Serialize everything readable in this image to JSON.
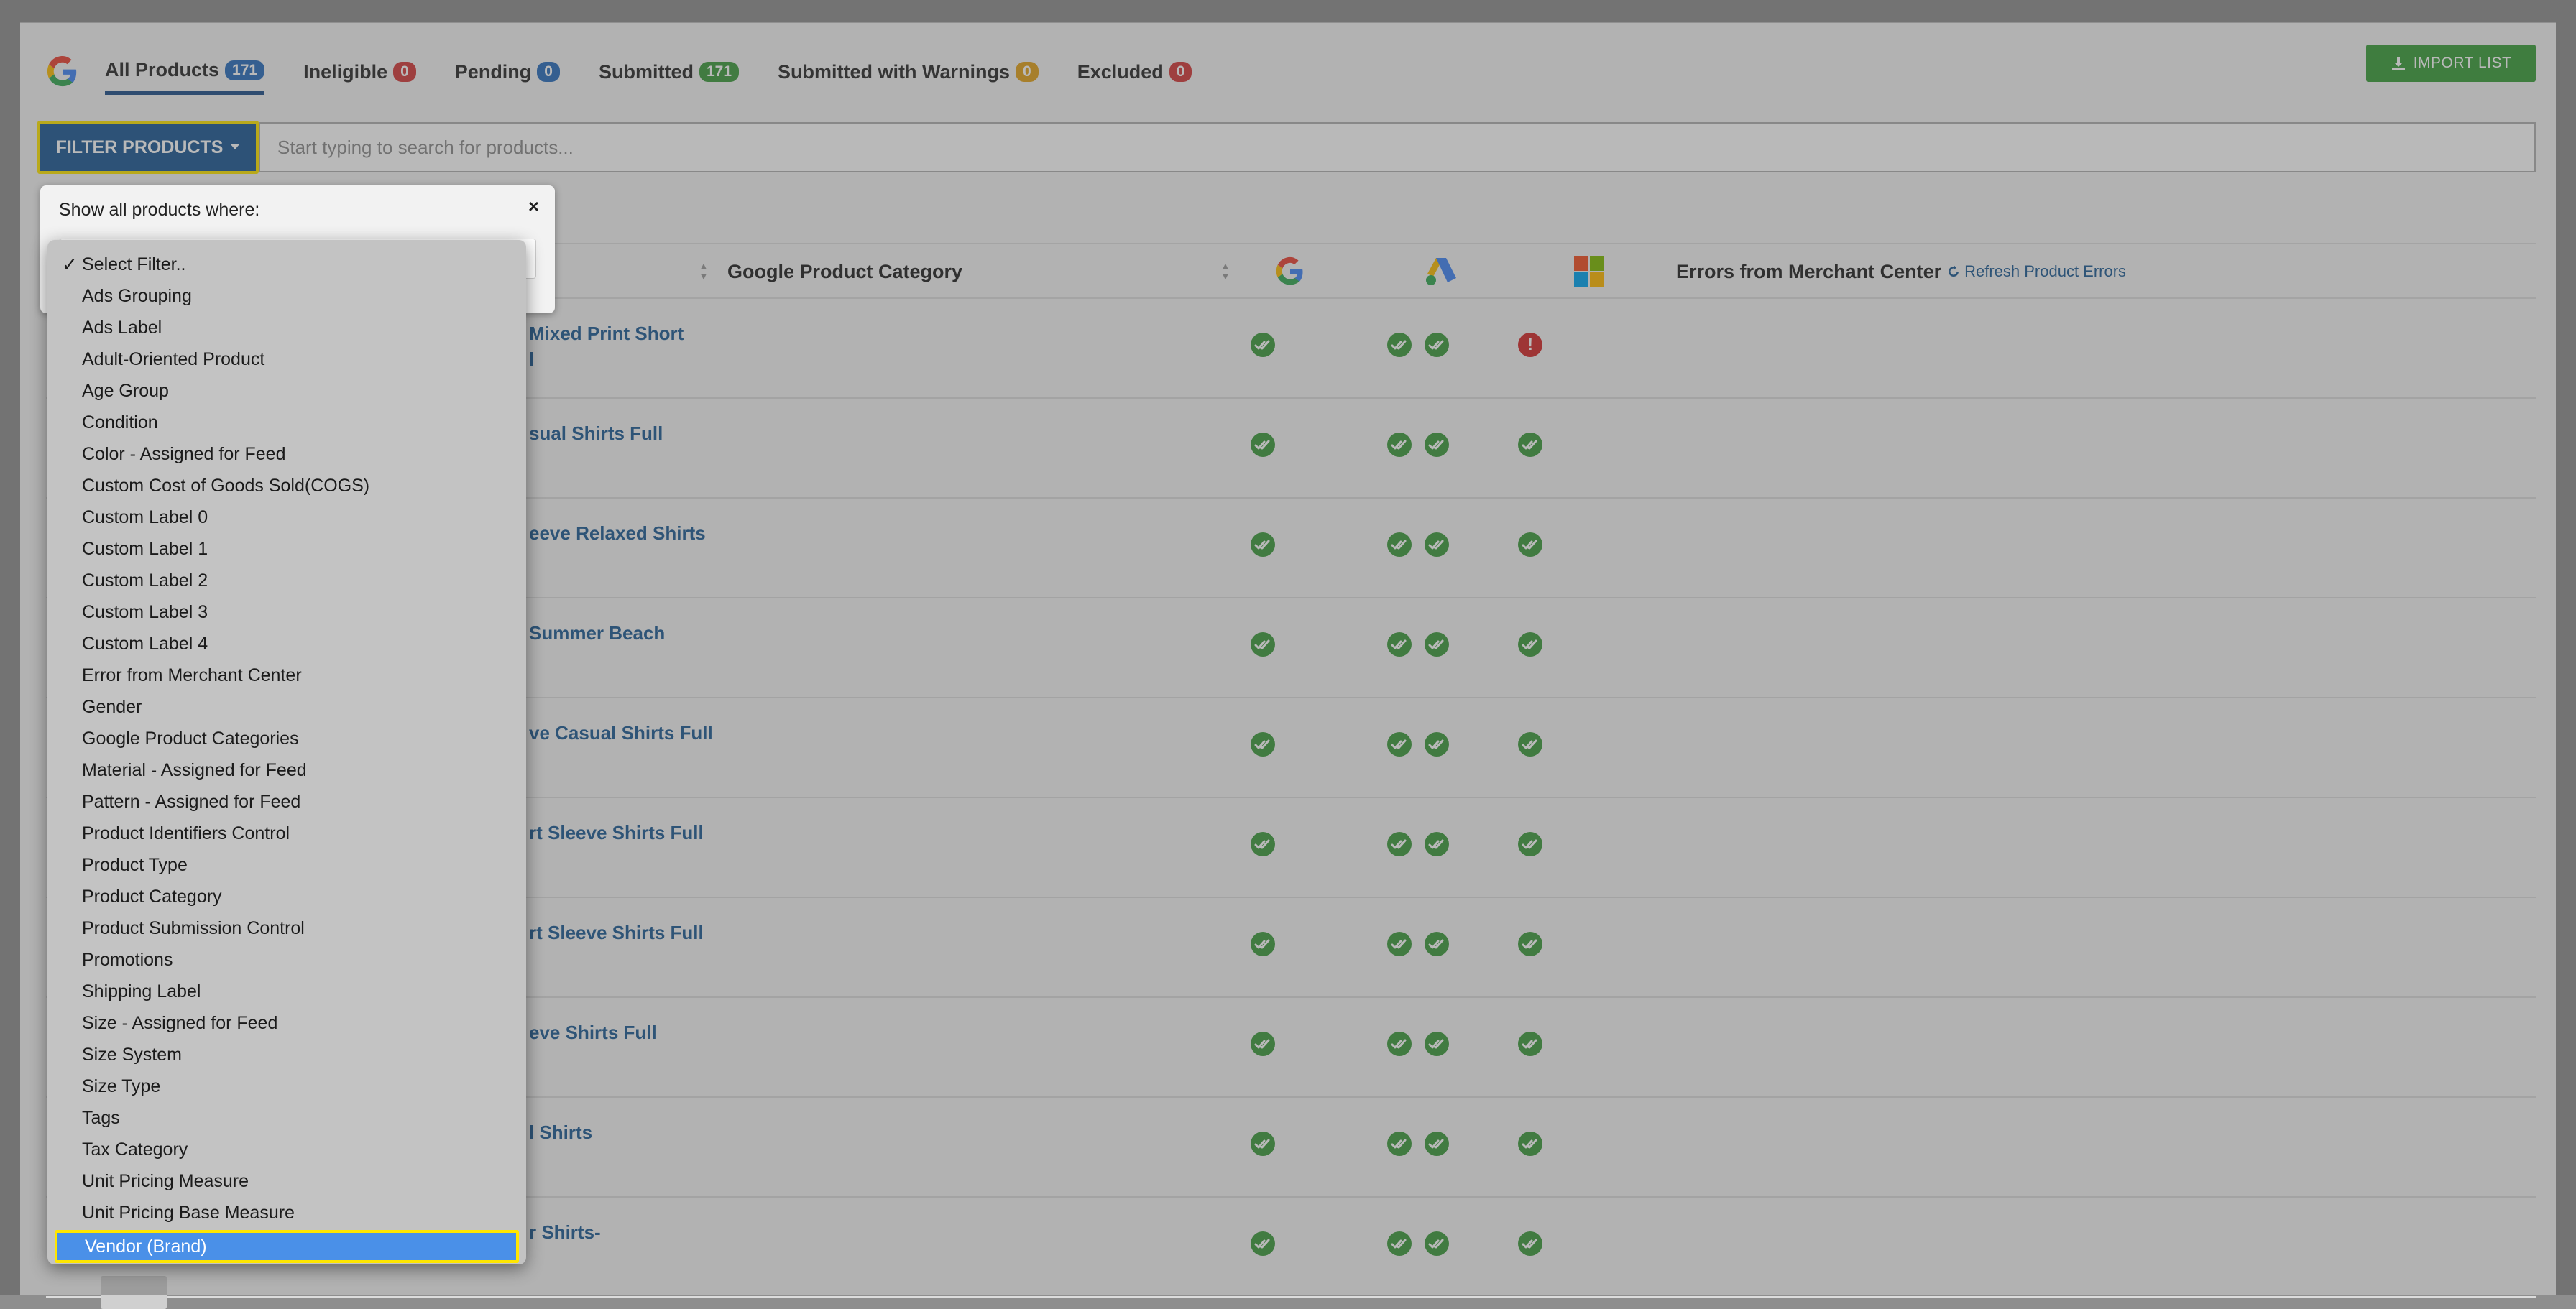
{
  "tabs": [
    {
      "label": "All Products",
      "count": "171"
    },
    {
      "label": "Ineligible",
      "count": "0"
    },
    {
      "label": "Pending",
      "count": "0"
    },
    {
      "label": "Submitted",
      "count": "171"
    },
    {
      "label": "Submitted with Warnings",
      "count": "0"
    },
    {
      "label": "Excluded",
      "count": "0"
    }
  ],
  "import_button": "IMPORT LIST",
  "filter_button": "FILTER PRODUCTS",
  "search": {
    "placeholder": "Start typing to search for products..."
  },
  "table": {
    "col_category": "Google Product Category",
    "col_errors": "Errors from Merchant Center",
    "refresh_link": "Refresh Product Errors",
    "rows": [
      {
        "title_line1": "Mixed Print Short",
        "title_line2": "l",
        "microsoft_status": "error"
      },
      {
        "title_line1": "sual Shirts Full",
        "title_line2": "",
        "microsoft_status": "ok"
      },
      {
        "title_line1": "eeve Relaxed Shirts",
        "title_line2": "",
        "microsoft_status": "ok"
      },
      {
        "title_line1": "Summer Beach",
        "title_line2": "",
        "microsoft_status": "ok"
      },
      {
        "title_line1": "ve Casual Shirts Full",
        "title_line2": "",
        "microsoft_status": "ok"
      },
      {
        "title_line1": "rt Sleeve Shirts Full",
        "title_line2": "",
        "microsoft_status": "ok"
      },
      {
        "title_line1": "rt Sleeve Shirts Full",
        "title_line2": "",
        "microsoft_status": "ok"
      },
      {
        "title_line1": "eve Shirts Full",
        "title_line2": "",
        "microsoft_status": "ok"
      },
      {
        "title_line1": "l Shirts",
        "title_line2": "",
        "microsoft_status": "ok"
      },
      {
        "title_line1": "r Shirts-",
        "title_line2": "",
        "microsoft_status": "ok"
      }
    ]
  },
  "popup": {
    "title": "Show all products where:",
    "close": "×"
  },
  "dropdown": {
    "selected_check": "✓",
    "items": [
      "Select Filter..",
      "Ads Grouping",
      "Ads Label",
      "Adult-Oriented Product",
      "Age Group",
      "Condition",
      "Color - Assigned for Feed",
      "Custom Cost of Goods Sold(COGS)",
      "Custom Label 0",
      "Custom Label 1",
      "Custom Label 2",
      "Custom Label 3",
      "Custom Label 4",
      "Error from Merchant Center",
      "Gender",
      "Google Product Categories",
      "Material - Assigned for Feed",
      "Pattern - Assigned for Feed",
      "Product Identifiers Control",
      "Product Type",
      "Product Category",
      "Product Submission Control",
      "Promotions",
      "Shipping Label",
      "Size - Assigned for Feed",
      "Size System",
      "Size Type",
      "Tags",
      "Tax Category",
      "Unit Pricing Measure",
      "Unit Pricing Base Measure",
      "Vendor (Brand)"
    ],
    "highlighted": "Vendor (Brand)"
  },
  "colors": {
    "accent": "#1d5a95",
    "success": "#3e9b3e",
    "error": "#d42a2a",
    "highlight": "#ffe600"
  }
}
